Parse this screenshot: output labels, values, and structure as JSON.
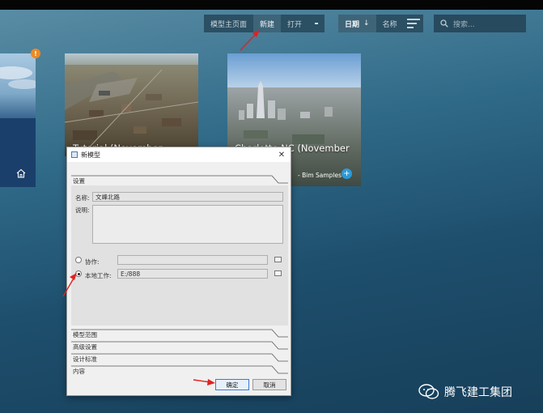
{
  "toolbar": {
    "group1": [
      {
        "label": "模型主页面",
        "active": false
      },
      {
        "label": "新建",
        "active": true
      },
      {
        "label": "打开",
        "active": false
      }
    ],
    "sort_date_label": "日期",
    "sort_arrow": "↓",
    "sort_name_label": "名称",
    "search_placeholder": "搜索..."
  },
  "cards": {
    "left": {
      "badge": "!",
      "icon": "home-icon"
    },
    "tutorial": {
      "title": "Tutorial (November"
    },
    "charlotte": {
      "title": "Charlotte NC (November",
      "subtitle": "- Bim Samples",
      "icon": "cloud-upload-icon"
    }
  },
  "dialog": {
    "title": "新模型",
    "close": "✕",
    "settings_header": "设置",
    "name_label": "名称:",
    "name_value": "文峰北路",
    "desc_label": "说明:",
    "collab_label": "协作:",
    "local_label": "本地工作:",
    "local_path": "E:/888",
    "selected_mode": "local",
    "sections": [
      "模型范围",
      "高级设置",
      "设计标准",
      "内容"
    ],
    "ok_label": "确定",
    "cancel_label": "取消"
  },
  "watermark": {
    "text": "腾飞建工集团",
    "icon": "wechat-icon"
  },
  "colors": {
    "accent_orange": "#ee8a24",
    "annotation_red": "#e02222",
    "cloud_blue": "#2c9ad8"
  }
}
